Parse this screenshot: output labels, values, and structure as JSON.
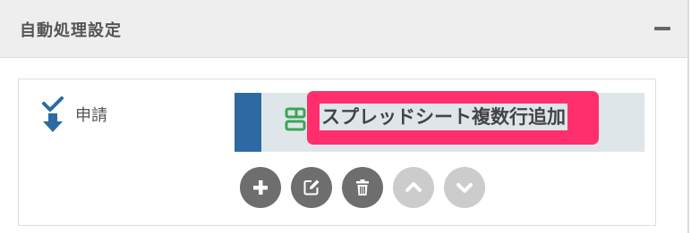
{
  "panel": {
    "title": "自動処理設定",
    "collapse_icon": "minus-icon"
  },
  "step": {
    "icon": "double-down-arrow-icon",
    "label": "申請"
  },
  "action": {
    "icon": "spreadsheet-icon",
    "title": "スプレッドシート複数行追加",
    "highlighted": true
  },
  "toolbar": {
    "buttons": [
      {
        "icon": "plus-icon",
        "enabled": true
      },
      {
        "icon": "edit-icon",
        "enabled": true
      },
      {
        "icon": "trash-icon",
        "enabled": true
      },
      {
        "icon": "chevron-up-icon",
        "enabled": false
      },
      {
        "icon": "chevron-down-icon",
        "enabled": false
      }
    ]
  },
  "colors": {
    "accent_blue": "#2d6aa3",
    "highlight": "#ff2f6d",
    "sheet_green": "#3aa655",
    "button_dark": "#6e6e6e",
    "button_disabled": "#cccccc"
  }
}
